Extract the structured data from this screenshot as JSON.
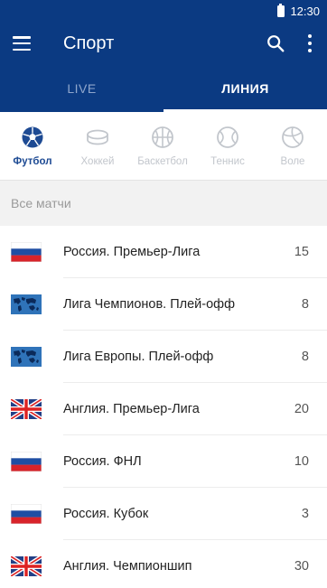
{
  "statusbar": {
    "time": "12:30"
  },
  "appbar": {
    "title": "Спорт",
    "icons": [
      "menu-icon",
      "search-icon",
      "more-vert-icon"
    ]
  },
  "tabs": [
    {
      "label": "LIVE",
      "active": false
    },
    {
      "label": "ЛИНИЯ",
      "active": true
    }
  ],
  "sports": [
    {
      "label": "Футбол",
      "icon": "soccer-ball-icon",
      "active": true
    },
    {
      "label": "Хоккей",
      "icon": "hockey-puck-icon",
      "active": false
    },
    {
      "label": "Баскетбол",
      "icon": "basketball-icon",
      "active": false
    },
    {
      "label": "Теннис",
      "icon": "tennis-ball-icon",
      "active": false
    },
    {
      "label": "Воле",
      "icon": "volleyball-icon",
      "active": false
    }
  ],
  "section": {
    "title": "Все матчи"
  },
  "leagues": [
    {
      "name": "Россия. Премьер-Лига",
      "count": "15",
      "flag": "russia"
    },
    {
      "name": "Лига Чемпионов. Плей-офф",
      "count": "8",
      "flag": "world"
    },
    {
      "name": "Лига Европы. Плей-офф",
      "count": "8",
      "flag": "world"
    },
    {
      "name": "Англия. Премьер-Лига",
      "count": "20",
      "flag": "uk"
    },
    {
      "name": "Россия. ФНЛ",
      "count": "10",
      "flag": "russia"
    },
    {
      "name": "Россия. Кубок",
      "count": "3",
      "flag": "russia"
    },
    {
      "name": "Англия. Чемпионшип",
      "count": "30",
      "flag": "uk"
    }
  ],
  "colors": {
    "primary": "#0b3a82",
    "active_sport": "#1d4a93",
    "inactive_sport": "#c2c6cc"
  }
}
